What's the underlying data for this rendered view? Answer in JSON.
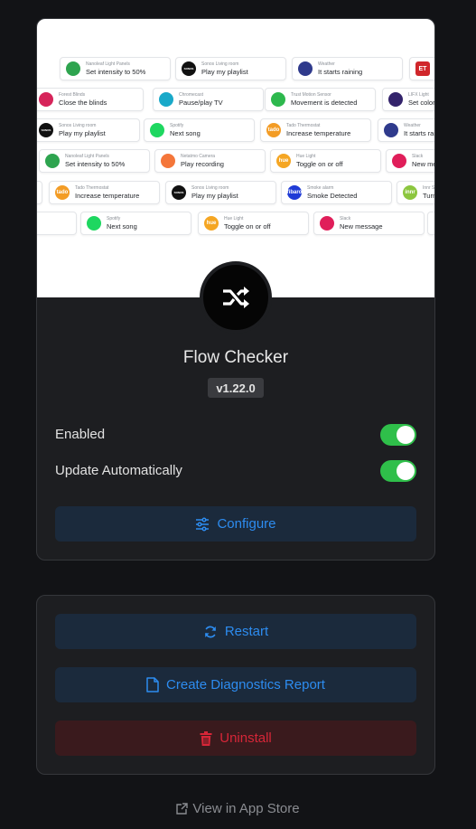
{
  "app": {
    "title": "Flow Checker",
    "version": "v1.22.0"
  },
  "hero": {
    "tiles": [
      {
        "device": "Nanoleaf Light Panels",
        "action": "Set intensity to 50%",
        "color": "#2ea44f",
        "glyph": ""
      },
      {
        "device": "Sonos Living room",
        "action": "Play my playlist",
        "color": "#111111",
        "glyph": "SONOS"
      },
      {
        "device": "Weather",
        "action": "It starts raining",
        "color": "#2f3a8c",
        "glyph": ""
      },
      {
        "device": "ET",
        "action": "",
        "color": "#d0262b",
        "glyph": "ET"
      },
      {
        "device": "Forest Blinds",
        "action": "Close the blinds",
        "color": "#d6245a",
        "glyph": ""
      },
      {
        "device": "Chromecast",
        "action": "Pause/play TV",
        "color": "#19a9c9",
        "glyph": ""
      },
      {
        "device": "Trust Motion Sensor",
        "action": "Movement is detected",
        "color": "#2db84d",
        "glyph": ""
      },
      {
        "device": "LIFX Light",
        "action": "Set color t",
        "color": "#33236b",
        "glyph": ""
      },
      {
        "device": "Sonos Living room",
        "action": "Play my playlist",
        "color": "#111111",
        "glyph": "SONOS"
      },
      {
        "device": "Spotify",
        "action": "Next song",
        "color": "#1ed760",
        "glyph": ""
      },
      {
        "device": "Tado Thermostat",
        "action": "Increase temperature",
        "color": "#f39c25",
        "glyph": "tado"
      },
      {
        "device": "Weather",
        "action": "It starts rain",
        "color": "#2f3a8c",
        "glyph": ""
      },
      {
        "device": "Nanoleaf Light Panels",
        "action": "Set intensity to 50%",
        "color": "#2ea44f",
        "glyph": ""
      },
      {
        "device": "Netatmo Camera",
        "action": "Play recording",
        "color": "#f4763a",
        "glyph": ""
      },
      {
        "device": "Hue Light",
        "action": "Toggle on or off",
        "color": "#f5a623",
        "glyph": "hue"
      },
      {
        "device": "Slack",
        "action": "New mes",
        "color": "#e01e5a",
        "glyph": ""
      },
      {
        "device": "Tado Thermostat",
        "action": "Increase temperature",
        "color": "#f39c25",
        "glyph": "tado"
      },
      {
        "device": "Sonos Living room",
        "action": "Play my playlist",
        "color": "#111111",
        "glyph": "SONOS"
      },
      {
        "device": "Smoke alarm",
        "action": "Smoke Detected",
        "color": "#1f3bd6",
        "glyph": "fibaro"
      },
      {
        "device": "Innr S",
        "action": "Turn",
        "color": "#8cc63f",
        "glyph": "innr"
      },
      {
        "device": "Spotify",
        "action": "Next song",
        "color": "#1ed760",
        "glyph": ""
      },
      {
        "device": "Hue Light",
        "action": "Toggle on or off",
        "color": "#f5a623",
        "glyph": "hue"
      },
      {
        "device": "Slack",
        "action": "New message",
        "color": "#e01e5a",
        "glyph": ""
      }
    ]
  },
  "settings": {
    "enabled_label": "Enabled",
    "enabled": true,
    "update_label": "Update Automatically",
    "update": true
  },
  "buttons": {
    "configure": "Configure",
    "restart": "Restart",
    "diagnostics": "Create Diagnostics Report",
    "uninstall": "Uninstall"
  },
  "footer": {
    "app_store_link": "View in App Store"
  },
  "colors": {
    "accent_blue": "#2d8cf0",
    "danger_red": "#d72638",
    "toggle_green": "#2fbf4a"
  }
}
